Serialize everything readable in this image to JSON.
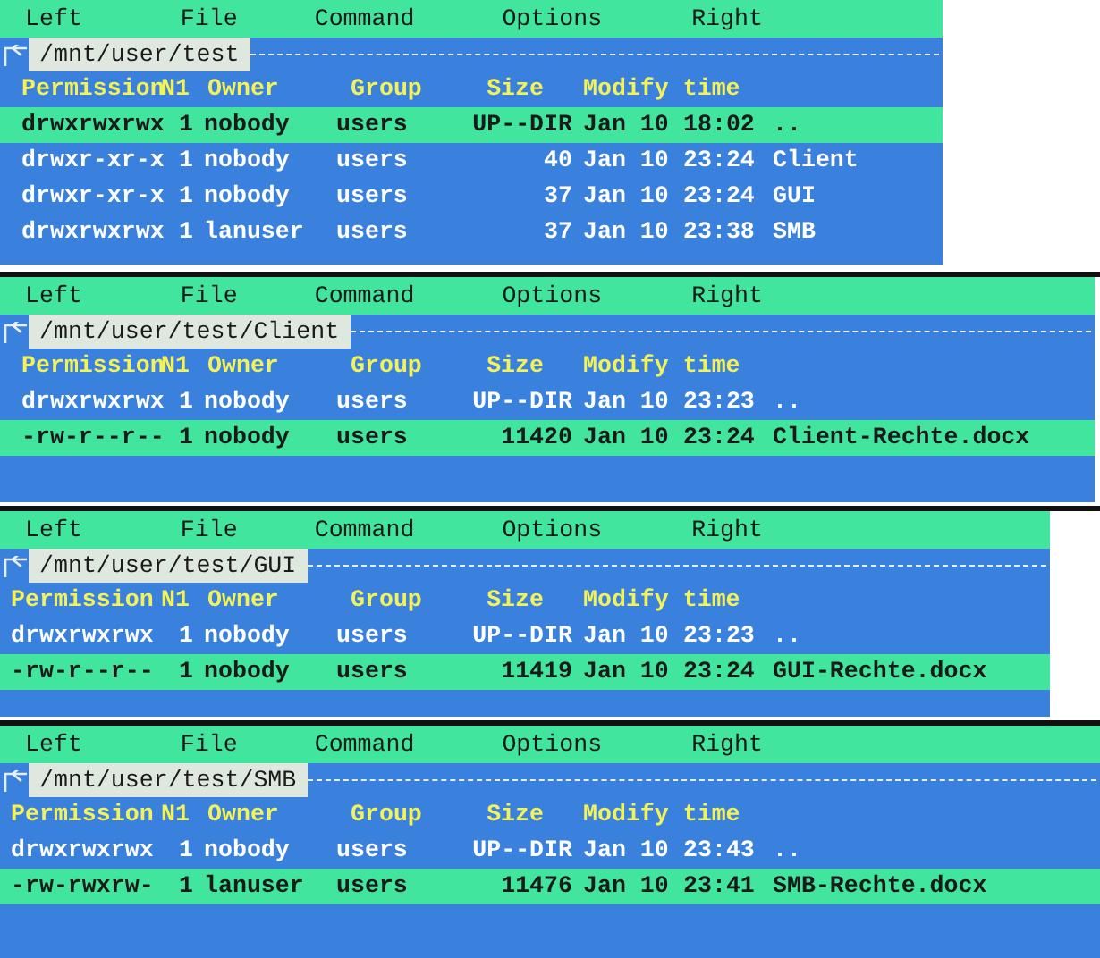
{
  "panels": [
    {
      "menu": [
        "Left",
        "File",
        "Command",
        "Options",
        "Right"
      ],
      "path": "/mnt/user/test",
      "columns": [
        "Permission",
        "N1",
        "Owner",
        "Group",
        "Size",
        "Modify time"
      ],
      "rows": [
        {
          "permission": "drwxrwxrwx",
          "links": "1",
          "owner": "nobody",
          "group": "users",
          "size": "UP--DIR",
          "date": "Jan 10",
          "time": "18:02",
          "name": "..",
          "selected": true
        },
        {
          "permission": "drwxr-xr-x",
          "links": "1",
          "owner": "nobody",
          "group": "users",
          "size": "40",
          "date": "Jan 10",
          "time": "23:24",
          "name": "Client",
          "selected": false
        },
        {
          "permission": "drwxr-xr-x",
          "links": "1",
          "owner": "nobody",
          "group": "users",
          "size": "37",
          "date": "Jan 10",
          "time": "23:24",
          "name": "GUI",
          "selected": false
        },
        {
          "permission": "drwxrwxrwx",
          "links": "1",
          "owner": "lanuser",
          "group": "users",
          "size": "37",
          "date": "Jan 10",
          "time": "23:38",
          "name": "SMB",
          "selected": false
        }
      ]
    },
    {
      "menu": [
        "Left",
        "File",
        "Command",
        "Options",
        "Right"
      ],
      "path": "/mnt/user/test/Client",
      "columns": [
        "Permission",
        "N1",
        "Owner",
        "Group",
        "Size",
        "Modify time"
      ],
      "rows": [
        {
          "permission": "drwxrwxrwx",
          "links": "1",
          "owner": "nobody",
          "group": "users",
          "size": "UP--DIR",
          "date": "Jan 10",
          "time": "23:23",
          "name": "..",
          "selected": false
        },
        {
          "permission": "-rw-r--r--",
          "links": "1",
          "owner": "nobody",
          "group": "users",
          "size": "11420",
          "date": "Jan 10",
          "time": "23:24",
          "name": "Client-Rechte.docx",
          "selected": true
        }
      ]
    },
    {
      "menu": [
        "Left",
        "File",
        "Command",
        "Options",
        "Right"
      ],
      "path": "/mnt/user/test/GUI",
      "columns": [
        "Permission",
        "N1",
        "Owner",
        "Group",
        "Size",
        "Modify time"
      ],
      "rows": [
        {
          "permission": "drwxrwxrwx",
          "links": "1",
          "owner": "nobody",
          "group": "users",
          "size": "UP--DIR",
          "date": "Jan 10",
          "time": "23:23",
          "name": "..",
          "selected": false
        },
        {
          "permission": "-rw-r--r--",
          "links": "1",
          "owner": "nobody",
          "group": "users",
          "size": "11419",
          "date": "Jan 10",
          "time": "23:24",
          "name": "GUI-Rechte.docx",
          "selected": true
        }
      ]
    },
    {
      "menu": [
        "Left",
        "File",
        "Command",
        "Options",
        "Right"
      ],
      "path": "/mnt/user/test/SMB",
      "columns": [
        "Permission",
        "N1",
        "Owner",
        "Group",
        "Size",
        "Modify time"
      ],
      "rows": [
        {
          "permission": "drwxrwxrwx",
          "links": "1",
          "owner": "nobody",
          "group": "users",
          "size": "UP--DIR",
          "date": "Jan 10",
          "time": "23:43",
          "name": "..",
          "selected": false
        },
        {
          "permission": "-rw-rwxrw-",
          "links": "1",
          "owner": "lanuser",
          "group": "users",
          "size": "11476",
          "date": "Jan 10",
          "time": "23:41",
          "name": "SMB-Rechte.docx",
          "selected": true
        }
      ]
    }
  ]
}
